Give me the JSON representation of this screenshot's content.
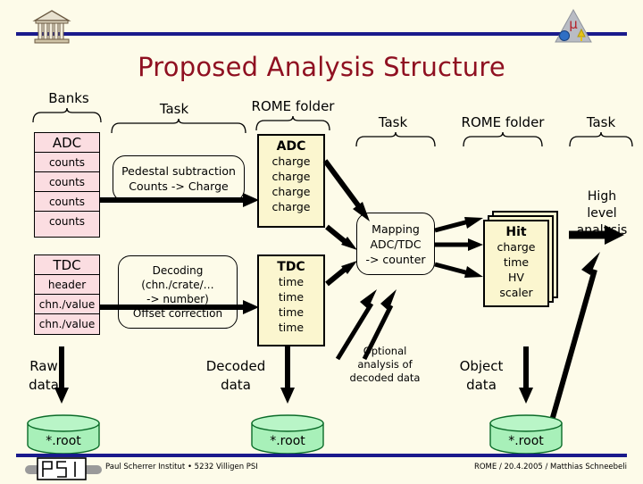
{
  "slide": {
    "title": "Proposed Analysis Structure",
    "background": "#fdfbe9",
    "title_color": "#8f1021",
    "rule_color": "#1a1a8c"
  },
  "captions": {
    "banks": "Banks",
    "task1": "Task",
    "rome_folder1": "ROME folder",
    "task2": "Task",
    "rome_folder2": "ROME folder",
    "task3": "Task"
  },
  "banks": {
    "adc": {
      "title": "ADC",
      "rows": [
        "counts",
        "counts",
        "counts",
        "counts"
      ]
    },
    "tdc": {
      "title": "TDC",
      "rows": [
        "header",
        "chn./value",
        "chn./value"
      ]
    }
  },
  "tasks": {
    "pedestal": {
      "line1": "Pedestal subtraction",
      "line2": "Counts -> Charge"
    },
    "decoding": {
      "line1": "Decoding",
      "line2": "(chn./crate/…",
      "line3": "-> number)",
      "line4": "Offset correction"
    },
    "mapping": {
      "line1": "Mapping",
      "line2": "ADC/TDC",
      "line3": "-> counter"
    },
    "high_level": {
      "line1": "High",
      "line2": "level",
      "line3": "analysis"
    }
  },
  "folders": {
    "adc": {
      "title": "ADC",
      "items": [
        "charge",
        "charge",
        "charge",
        "charge"
      ]
    },
    "tdc": {
      "title": "TDC",
      "items": [
        "time",
        "time",
        "time",
        "time"
      ]
    },
    "hit": {
      "title": "Hit",
      "items": [
        "charge",
        "time",
        "HV",
        "scaler"
      ]
    }
  },
  "annotations": {
    "optional": "Optional\nanalysis of\ndecoded data",
    "raw_data": "Raw\ndata",
    "decoded_data": "Decoded\ndata",
    "object_data": "Object\ndata"
  },
  "storage": [
    {
      "label": "*.root"
    },
    {
      "label": "*.root"
    },
    {
      "label": "*.root"
    }
  ],
  "footer": {
    "left": "Paul Scherrer Institut • 5232 Villigen PSI",
    "right": "ROME / 20.4.2005 / Matthias Schneebeli"
  },
  "icons": {
    "temple": "temple-icon",
    "triangle": "triangle-mu-icon",
    "psi": "psi-logo"
  }
}
